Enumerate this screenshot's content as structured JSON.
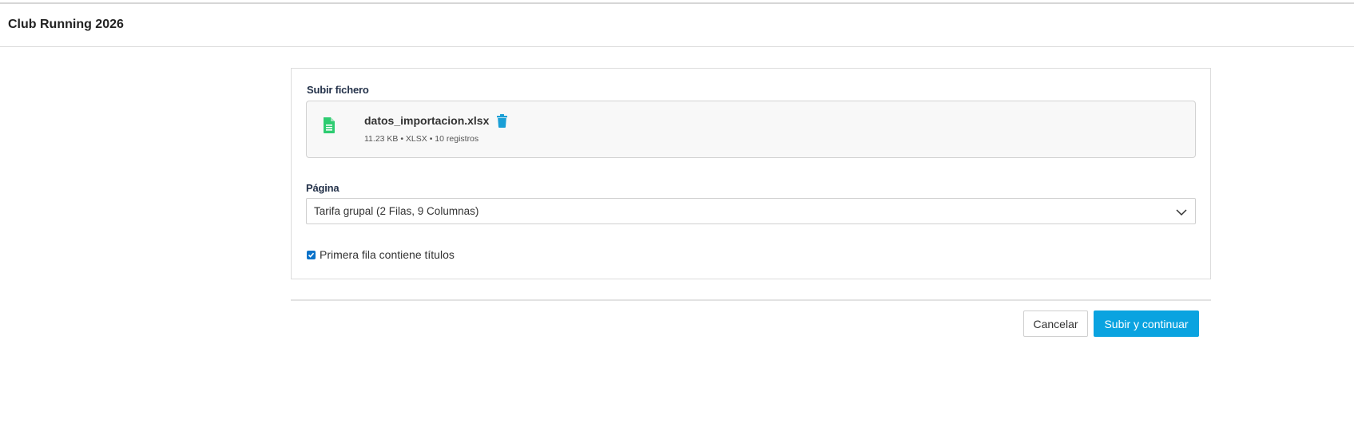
{
  "header": {
    "title": "Club Running 2026"
  },
  "upload": {
    "label": "Subir fichero",
    "file_name": "datos_importacion.xlsx",
    "file_meta": "11.23 KB • XLSX • 10 registros",
    "file_icon": "file-spreadsheet-icon",
    "delete_icon": "trash-icon"
  },
  "page_select": {
    "label": "Página",
    "value": "Tarifa grupal (2 Filas, 9 Columnas)"
  },
  "options": {
    "first_row_titles_label": "Primera fila contiene títulos",
    "first_row_titles_checked": true
  },
  "actions": {
    "cancel_label": "Cancelar",
    "submit_label": "Subir y continuar"
  },
  "colors": {
    "primary": "#0aa3e0",
    "file_icon": "#2ecc71",
    "trash_icon": "#1a9fd6",
    "checkbox": "#0a72c9"
  }
}
